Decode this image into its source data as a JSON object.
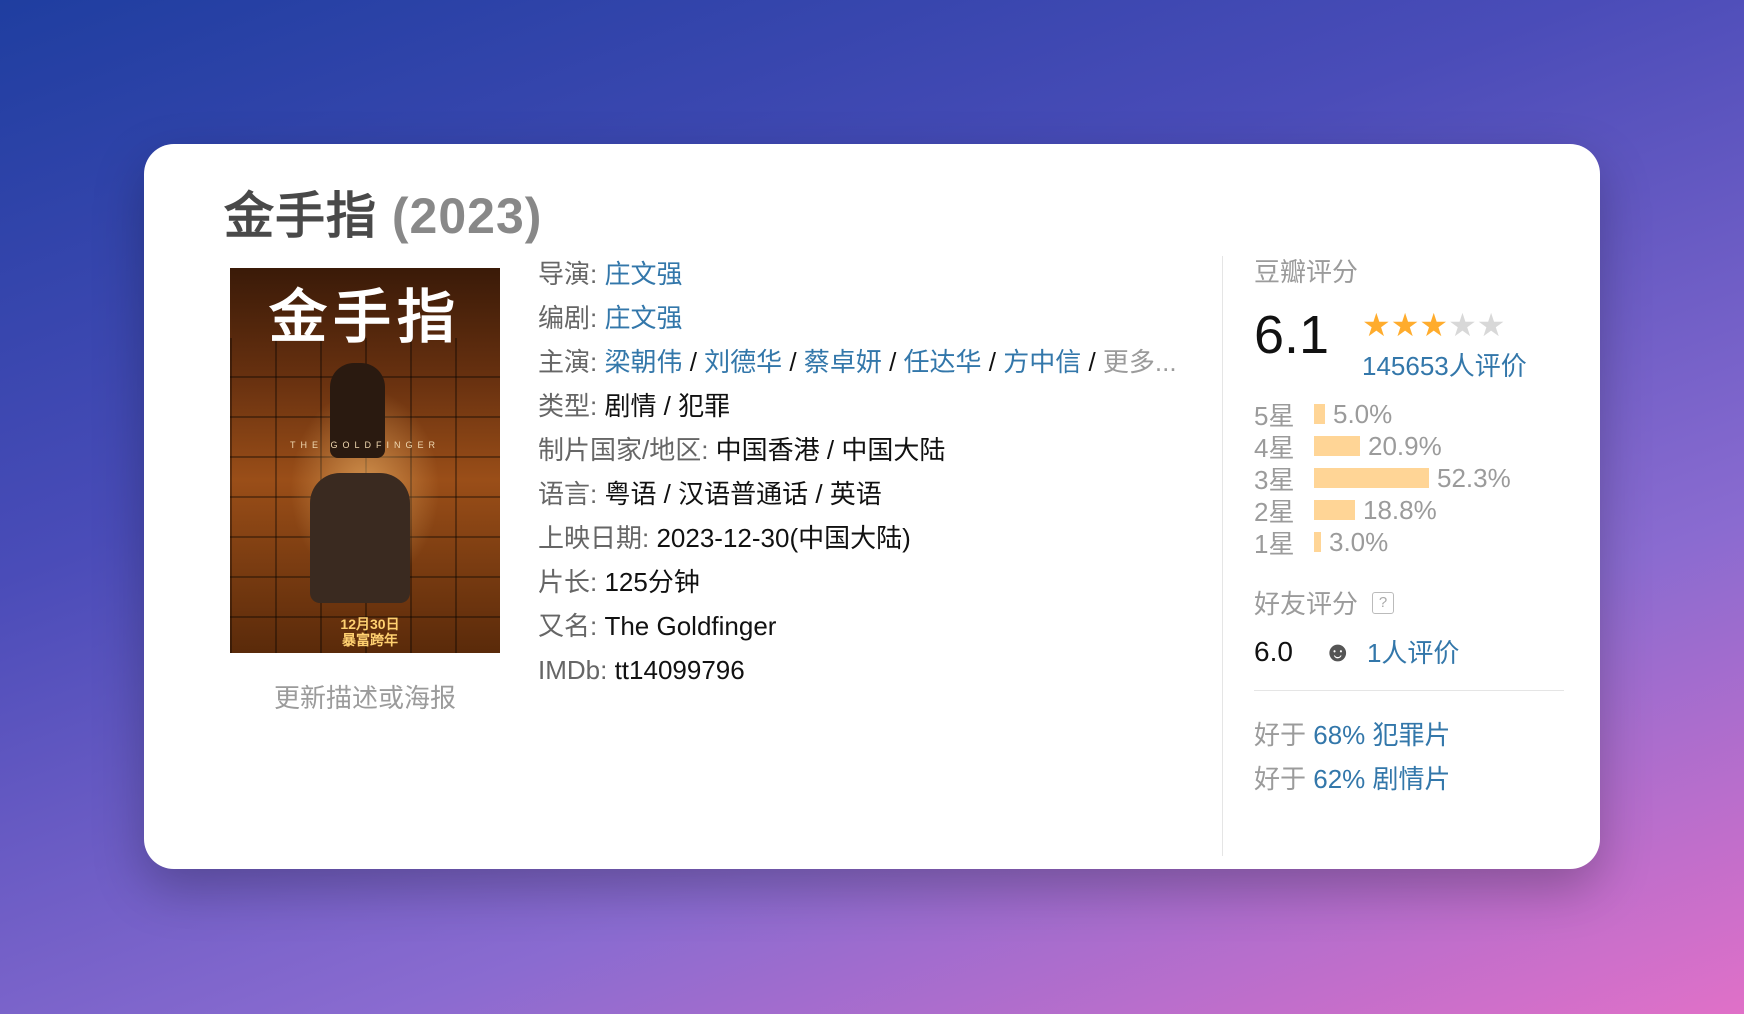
{
  "movie": {
    "title": "金手指",
    "year": "(2023)"
  },
  "poster": {
    "title_art": "金手指",
    "english_title": "THE GOLDFINGER",
    "date_line1": "12月30日",
    "date_line2": "暴富跨年",
    "update_link": "更新描述或海报"
  },
  "info": {
    "director_label": "导演: ",
    "director": "庄文强",
    "writer_label": "编剧: ",
    "writer": "庄文强",
    "cast_label": "主演: ",
    "cast": [
      "梁朝伟",
      "刘德华",
      "蔡卓妍",
      "任达华",
      "方中信"
    ],
    "cast_sep": " / ",
    "cast_more": "更多...",
    "genre_label": "类型: ",
    "genre": "剧情 / 犯罪",
    "country_label": "制片国家/地区: ",
    "country": "中国香港 / 中国大陆",
    "language_label": "语言: ",
    "language": "粤语 / 汉语普通话 / 英语",
    "release_label": "上映日期: ",
    "release": "2023-12-30(中国大陆)",
    "runtime_label": "片长: ",
    "runtime": "125分钟",
    "aka_label": "又名: ",
    "aka": "The Goldfinger",
    "imdb_label": "IMDb: ",
    "imdb": "tt14099796"
  },
  "rating": {
    "header": "豆瓣评分",
    "score": "6.1",
    "stars_filled": 3,
    "stars_total": 5,
    "votes": "145653人评价",
    "distribution": [
      {
        "label": "5星",
        "percent": 5.0,
        "text": "5.0%"
      },
      {
        "label": "4星",
        "percent": 20.9,
        "text": "20.9%"
      },
      {
        "label": "3星",
        "percent": 52.3,
        "text": "52.3%"
      },
      {
        "label": "2星",
        "percent": 18.8,
        "text": "18.8%"
      },
      {
        "label": "1星",
        "percent": 3.0,
        "text": "3.0%"
      }
    ],
    "friend_header": "好友评分",
    "friend_help": "?",
    "friend_score": "6.0",
    "friend_votes": "1人评价",
    "better_prefix": "好于 ",
    "better": [
      {
        "pct": "68%",
        "genre": "犯罪片"
      },
      {
        "pct": "62%",
        "genre": "剧情片"
      }
    ]
  },
  "colors": {
    "link": "#3377aa",
    "star": "#ffac2d",
    "bar": "#ffd596"
  }
}
